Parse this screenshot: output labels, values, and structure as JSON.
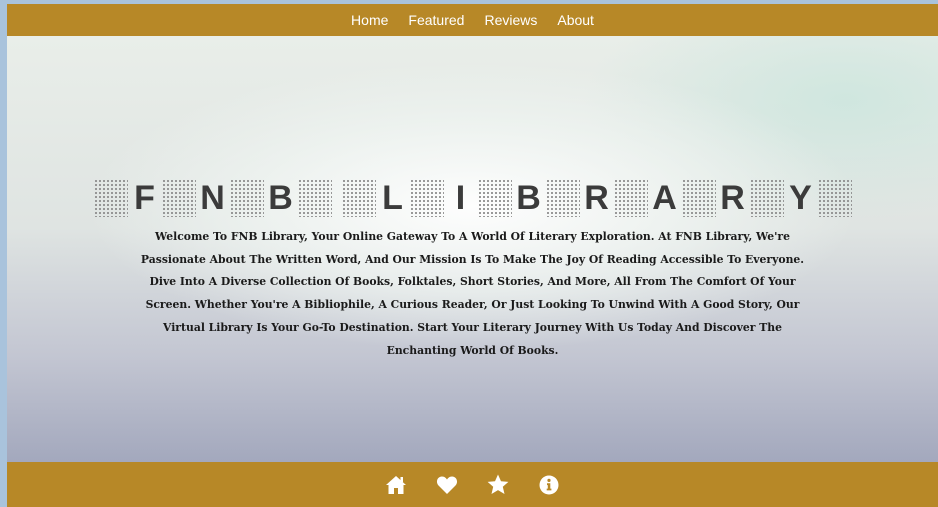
{
  "topnav": {
    "items": [
      {
        "label": "Home"
      },
      {
        "label": "Featured"
      },
      {
        "label": "Reviews"
      },
      {
        "label": "About"
      }
    ]
  },
  "hero": {
    "title_letters": [
      "F",
      "N",
      "B",
      "",
      "L",
      "I",
      "B",
      "R",
      "A",
      "R",
      "Y"
    ],
    "paragraph": "Welcome To FNB Library, Your Online Gateway To A World Of Literary Exploration. At FNB Library, We're Passionate About The Written Word, And Our Mission Is To Make The Joy Of Reading Accessible To Everyone. Dive Into A Diverse Collection Of Books, Folktales, Short Stories, And More, All From The Comfort Of Your Screen. Whether You're A Bibliophile, A Curious Reader, Or Just Looking To Unwind With A Good Story, Our Virtual Library Is Your Go-To Destination. Start Your Literary Journey With Us Today And Discover The Enchanting World Of Books."
  },
  "bottomnav": {
    "icons": [
      "home-icon",
      "heart-icon",
      "star-icon",
      "info-icon"
    ]
  },
  "colors": {
    "nav_bar": "#b78827",
    "nav_text": "#ffffff",
    "title_text": "#3b3b3b",
    "body_text": "#1a1a1a"
  }
}
